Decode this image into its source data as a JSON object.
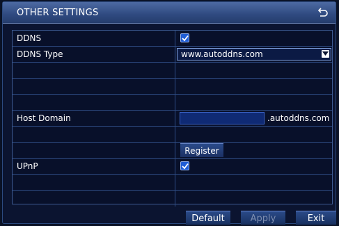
{
  "window": {
    "title": "OTHER SETTINGS",
    "back_icon": "back-arrow-icon"
  },
  "settings": {
    "ddns_label": "DDNS",
    "ddns_checked": true,
    "ddns_type_label": "DDNS Type",
    "ddns_type_value": "www.autoddns.com",
    "host_domain_label": "Host Domain",
    "host_domain_value": "",
    "host_domain_suffix": ".autoddns.com",
    "register_label": "Register",
    "upnp_label": "UPnP",
    "upnp_checked": true
  },
  "buttons": {
    "default": "Default",
    "apply": "Apply",
    "exit": "Exit"
  },
  "colors": {
    "title_bar": "#3a5791",
    "check_blue": "#1f5dd6",
    "grid_line": "#2f4d86"
  }
}
